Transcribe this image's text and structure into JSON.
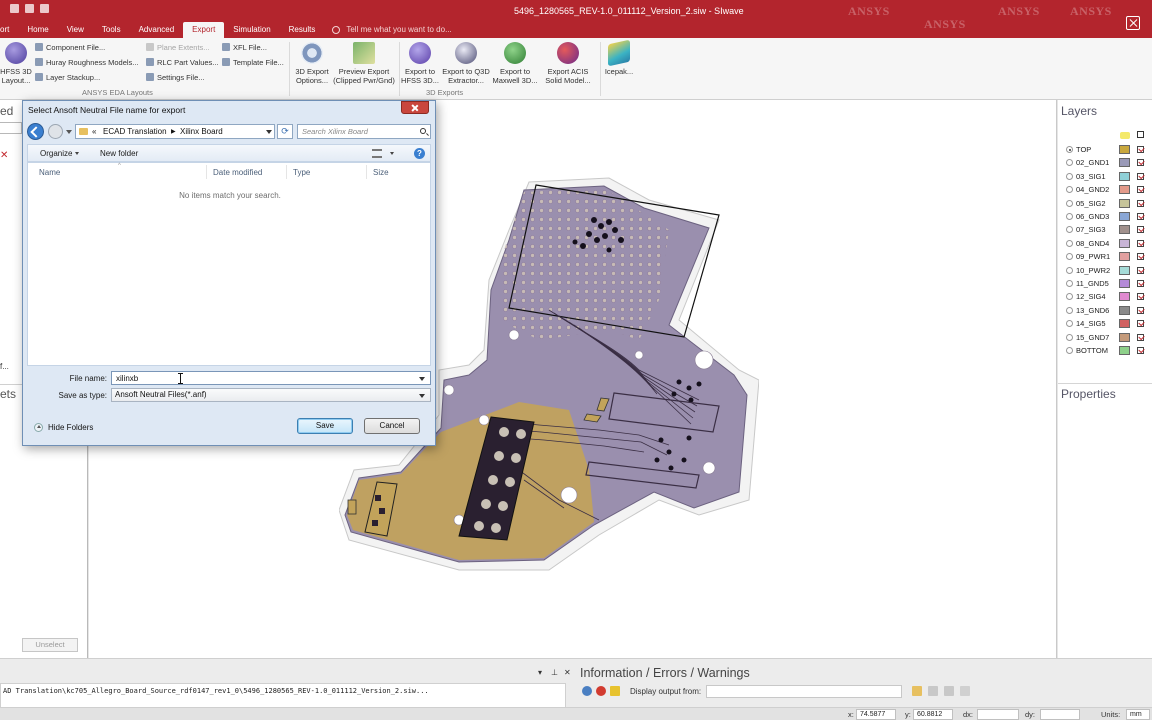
{
  "window": {
    "title": "5496_1280565_REV-1.0_011112_Version_2.siw - SIwave",
    "watermark": "ANSYS"
  },
  "tabs": [
    {
      "label": "ort",
      "active": false
    },
    {
      "label": "Home",
      "active": false
    },
    {
      "label": "View",
      "active": false
    },
    {
      "label": "Tools",
      "active": false
    },
    {
      "label": "Advanced",
      "active": false
    },
    {
      "label": "Export",
      "active": true
    },
    {
      "label": "Simulation",
      "active": false
    },
    {
      "label": "Results",
      "active": false
    }
  ],
  "tell_me": "Tell me what you want to do...",
  "ribbon": {
    "hfss_layout": "HFSS 3D Layout...",
    "component_file": "Component File...",
    "huray": "Huray Roughness Models...",
    "layer_stackup": "Layer Stackup...",
    "plane_extents": "Plane Extents...",
    "rlc_values": "RLC Part Values...",
    "settings_file": "Settings File...",
    "xfl_file": "XFL File...",
    "template_file": "Template File...",
    "group_eda": "ANSYS EDA Layouts",
    "export_options": "3D Export Options...",
    "preview_export": "Preview Export (Clipped Pwr/Gnd)",
    "export_hfss": "Export to HFSS 3D...",
    "export_q3d": "Export to Q3D Extractor...",
    "export_maxwell": "Export to Maxwell 3D...",
    "export_acis": "Export ACIS Solid Model...",
    "icepak": "Icepak...",
    "group_3d": "3D Exports"
  },
  "left_panel": {
    "header1": "ed",
    "header2": "ets",
    "frag": "f...",
    "unselect": "Unselect"
  },
  "layers_panel": {
    "title": "Layers",
    "properties_title": "Properties",
    "layers": [
      {
        "name": "TOP",
        "color": "#c9a83e",
        "selected": true
      },
      {
        "name": "02_GND1",
        "color": "#9a9ab8",
        "selected": false
      },
      {
        "name": "03_SIG1",
        "color": "#8fd0d8",
        "selected": false
      },
      {
        "name": "04_GND2",
        "color": "#e39a8a",
        "selected": false
      },
      {
        "name": "05_SIG2",
        "color": "#c6c49a",
        "selected": false
      },
      {
        "name": "06_GND3",
        "color": "#8aa7d6",
        "selected": false
      },
      {
        "name": "07_SIG3",
        "color": "#a0908c",
        "selected": false
      },
      {
        "name": "08_GND4",
        "color": "#c8b4d6",
        "selected": false
      },
      {
        "name": "09_PWR1",
        "color": "#e2a0a0",
        "selected": false
      },
      {
        "name": "10_PWR2",
        "color": "#a6dcd8",
        "selected": false
      },
      {
        "name": "11_GND5",
        "color": "#b48ad8",
        "selected": false
      },
      {
        "name": "12_SIG4",
        "color": "#e08ad0",
        "selected": false
      },
      {
        "name": "13_GND6",
        "color": "#8a8a8a",
        "selected": false
      },
      {
        "name": "14_SIG5",
        "color": "#d06060",
        "selected": false
      },
      {
        "name": "15_GND7",
        "color": "#c49a7a",
        "selected": false
      },
      {
        "name": "BOTTOM",
        "color": "#8ed08a",
        "selected": false
      }
    ]
  },
  "dialog": {
    "title": "Select Ansoft Neutral File name for export",
    "breadcrumb_prefix": "«",
    "path": [
      "ECAD Translation",
      "Xilinx Board"
    ],
    "search_placeholder": "Search Xilinx Board",
    "organize": "Organize",
    "new_folder": "New folder",
    "columns": [
      "Name",
      "Date modified",
      "Type",
      "Size"
    ],
    "empty_message": "No items match your search.",
    "file_name_label": "File name:",
    "file_name_value": "xilinxb",
    "save_as_type_label": "Save as type:",
    "save_as_type_value": "Ansoft Neutral Files(*.anf)",
    "hide_folders": "Hide Folders",
    "save": "Save",
    "cancel": "Cancel"
  },
  "messages": {
    "path_text": "AD Translation\\kc705_Allegro_Board_Source_rdf0147_rev1_0\\5496_1280565_REV-1.0_011112_Version_2.siw..."
  },
  "info_panel": {
    "title": "Information / Errors / Warnings",
    "display_output_label": "Display output from:"
  },
  "status": {
    "x_label": "x:",
    "x_value": "74.5877",
    "y_label": "y:",
    "y_value": "60.8812",
    "dx_label": "dx:",
    "dy_label": "dy:",
    "units_label": "Units:",
    "units_value": "mm"
  },
  "colors": {
    "brand_red": "#b3252d",
    "pcb_fill": "#9a8fae",
    "pcb_gold": "#c2a35a"
  }
}
